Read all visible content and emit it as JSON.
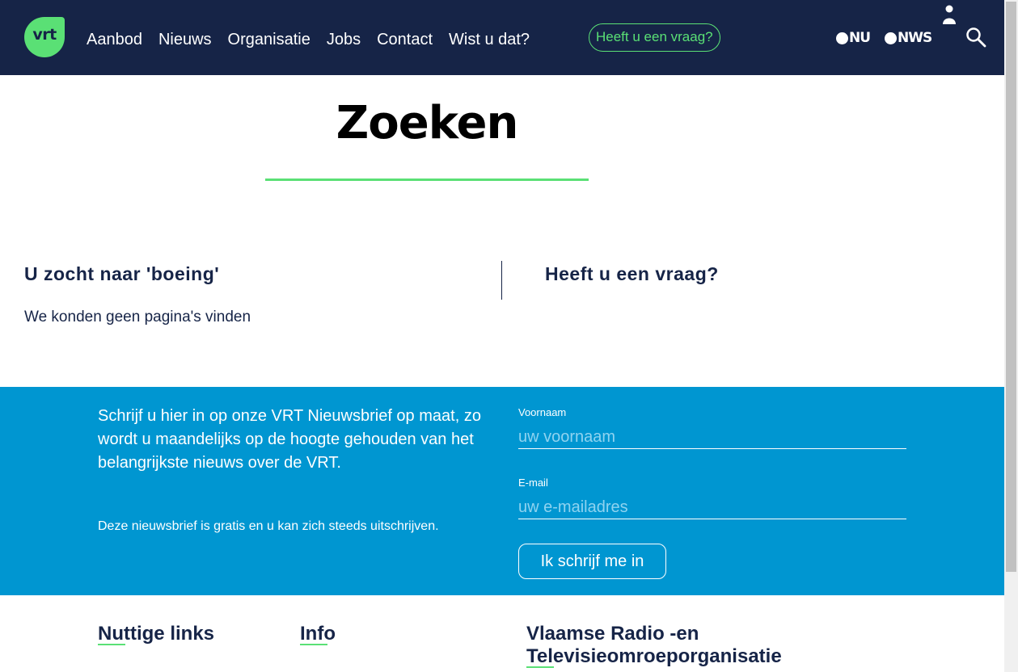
{
  "header": {
    "logo_text": "vrt",
    "nav": [
      "Aanbod",
      "Nieuws",
      "Organisatie",
      "Jobs",
      "Contact",
      "Wist u dat?"
    ],
    "question_button": "Heeft u een vraag?",
    "brand_nu": "NU",
    "brand_nws": "NWS",
    "user_icon": "user-icon",
    "search_icon": "search-icon"
  },
  "main": {
    "title": "Zoeken",
    "result_heading": "U zocht naar 'boeing'",
    "result_text": "We konden geen pagina's vinden",
    "question_heading": "Heeft u een vraag?"
  },
  "newsletter": {
    "text": "Schrijf u hier in op onze VRT Nieuwsbrief op maat, zo wordt u maandelijks op de hoogte gehouden van het belangrijkste nieuws over de VRT.",
    "note": "Deze nieuwsbrief is gratis en u kan zich steeds uitschrijven.",
    "firstname_label": "Voornaam",
    "firstname_placeholder": "uw voornaam",
    "email_label": "E-mail",
    "email_placeholder": "uw e-mailadres",
    "submit_label": "Ik schrijf me in"
  },
  "footer": {
    "col1_heading": "Nuttige links",
    "col2_heading": "Info",
    "col3_heading_line1": "Vlaamse Radio -en",
    "col3_heading_line2": "Televisieomroeporganisatie"
  },
  "colors": {
    "navy": "#162447",
    "green": "#5ae075",
    "blue": "#0096d1"
  }
}
